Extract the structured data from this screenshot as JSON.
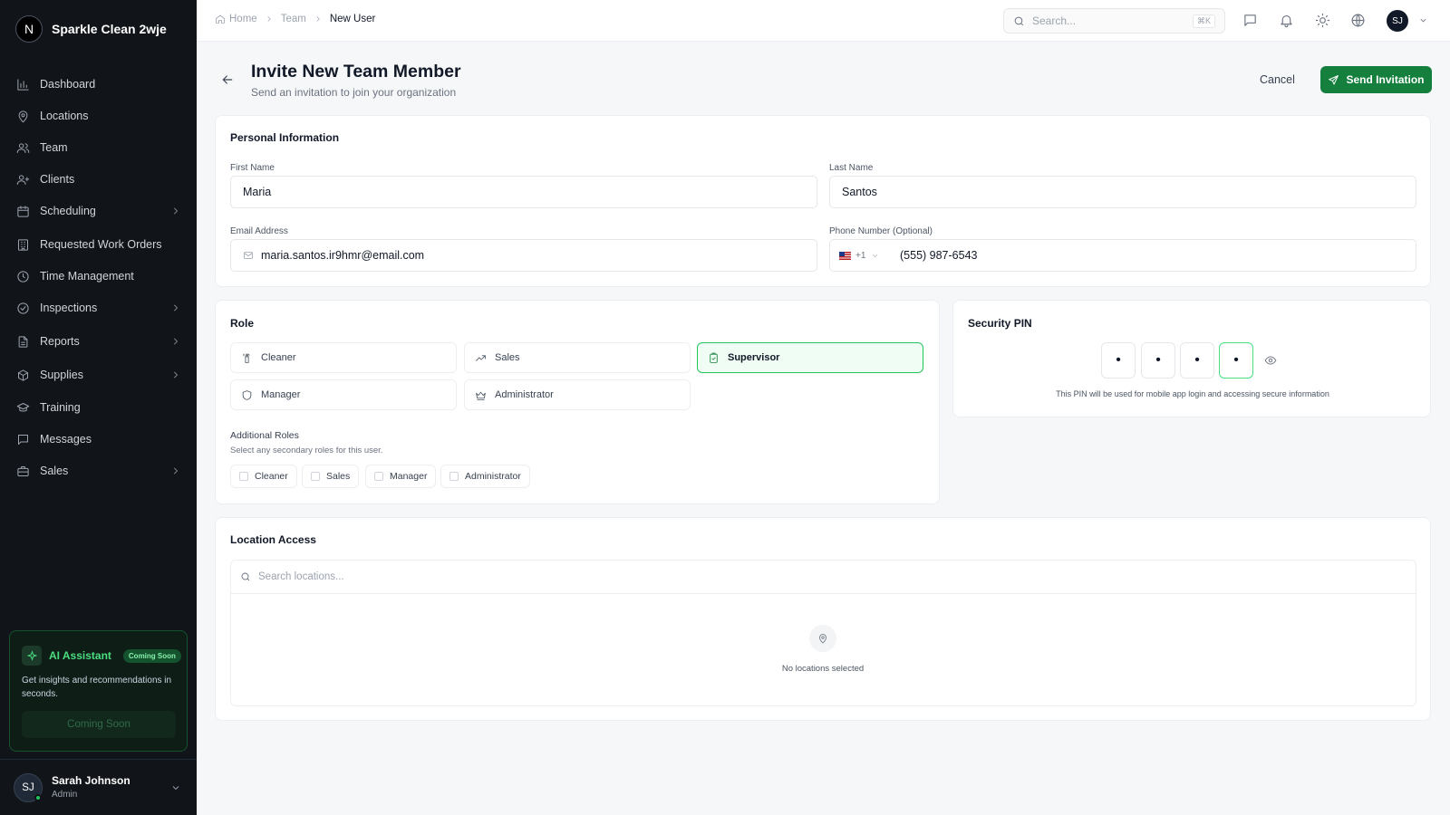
{
  "brand": {
    "logo_letter": "N",
    "name": "Sparkle Clean 2wje"
  },
  "sidebar": {
    "items": [
      {
        "label": "Dashboard",
        "icon": "bar-chart-icon",
        "has_chevron": false
      },
      {
        "label": "Locations",
        "icon": "map-pin-icon",
        "has_chevron": false
      },
      {
        "label": "Team",
        "icon": "users-icon",
        "has_chevron": false
      },
      {
        "label": "Clients",
        "icon": "user-plus-icon",
        "has_chevron": false
      },
      {
        "label": "Scheduling",
        "icon": "calendar-icon",
        "has_chevron": true
      },
      {
        "label": "Requested Work Orders",
        "icon": "building-icon",
        "has_chevron": false
      },
      {
        "label": "Time Management",
        "icon": "clock-icon",
        "has_chevron": false
      },
      {
        "label": "Inspections",
        "icon": "check-circle-icon",
        "has_chevron": true
      },
      {
        "label": "Reports",
        "icon": "file-text-icon",
        "has_chevron": true
      },
      {
        "label": "Supplies",
        "icon": "package-icon",
        "has_chevron": true
      },
      {
        "label": "Training",
        "icon": "graduation-cap-icon",
        "has_chevron": false
      },
      {
        "label": "Messages",
        "icon": "message-square-icon",
        "has_chevron": false
      },
      {
        "label": "Sales",
        "icon": "briefcase-icon",
        "has_chevron": true
      }
    ],
    "ai_card": {
      "title": "AI Assistant",
      "badge": "Coming Soon",
      "description": "Get insights and recommendations in seconds.",
      "button_label": "Coming Soon"
    },
    "user": {
      "initials": "SJ",
      "name": "Sarah Johnson",
      "role": "Admin"
    }
  },
  "topbar": {
    "breadcrumb": {
      "home": "Home",
      "team": "Team",
      "current": "New User"
    },
    "search_placeholder": "Search...",
    "search_shortcut": "⌘K",
    "avatar_initials": "SJ"
  },
  "page": {
    "title": "Invite New Team Member",
    "subtitle": "Send an invitation to join your organization",
    "cancel_label": "Cancel",
    "send_label": "Send Invitation"
  },
  "personal": {
    "title": "Personal Information",
    "first_name_label": "First Name",
    "first_name_value": "Maria",
    "last_name_label": "Last Name",
    "last_name_value": "Santos",
    "email_label": "Email Address",
    "email_value": "maria.santos.ir9hmr@email.com",
    "phone_label": "Phone Number (Optional)",
    "phone_country": "+1",
    "phone_value": "(555) 987-6543"
  },
  "role": {
    "title": "Role",
    "options": [
      "Cleaner",
      "Sales",
      "Supervisor",
      "Manager",
      "Administrator"
    ],
    "selected": "Supervisor",
    "additional_title": "Additional Roles",
    "additional_desc": "Select any secondary roles for this user.",
    "additional_options": [
      "Cleaner",
      "Sales",
      "Manager",
      "Administrator"
    ]
  },
  "pin": {
    "title": "Security PIN",
    "digits": [
      "•",
      "•",
      "•",
      "•"
    ],
    "note": "This PIN will be used for mobile app login and accessing secure information"
  },
  "locations": {
    "title": "Location Access",
    "search_placeholder": "Search locations...",
    "empty_text": "No locations selected"
  },
  "colors": {
    "accent": "#15803d",
    "sidebar_bg": "#111419",
    "selected_border": "#22c55e"
  }
}
